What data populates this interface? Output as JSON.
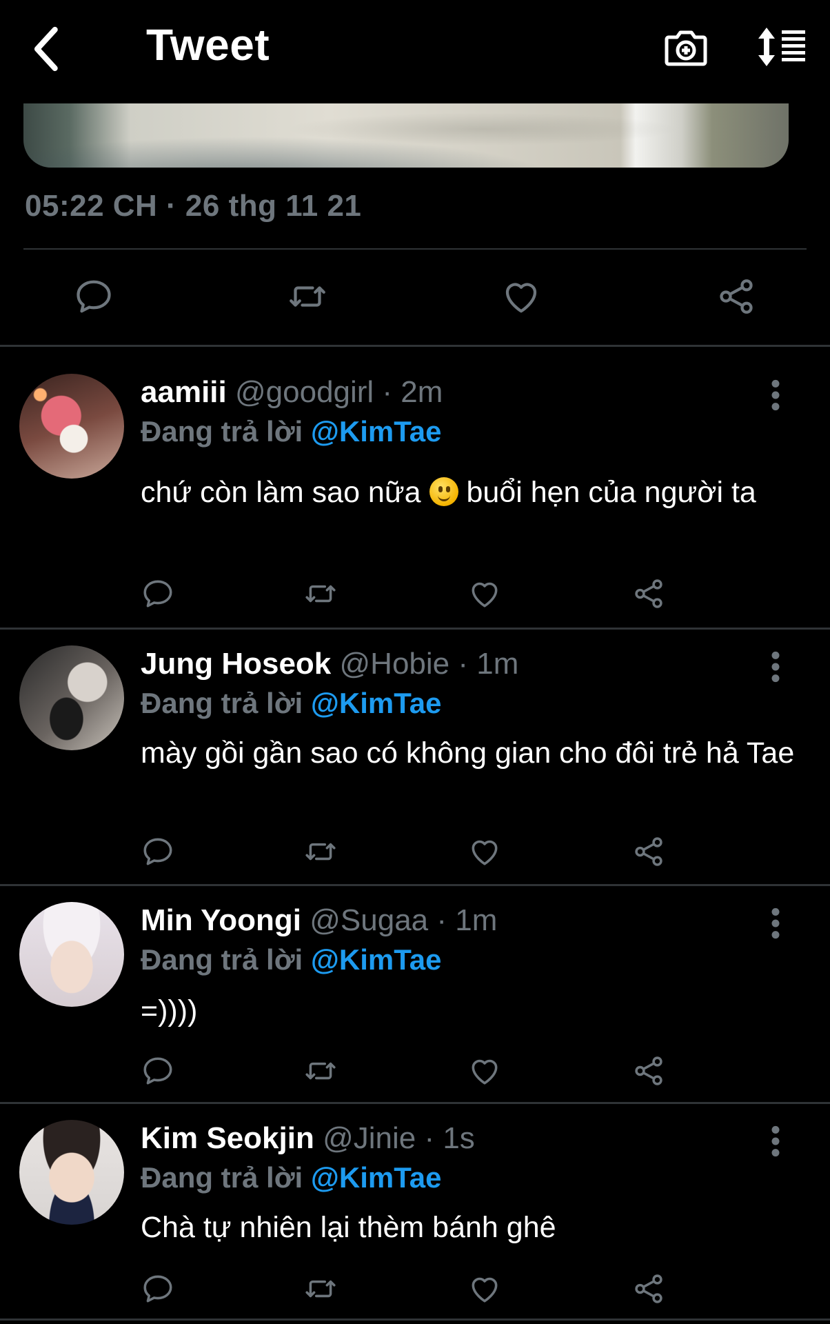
{
  "header": {
    "title": "Tweet",
    "back_icon": "chevron-left-icon",
    "camera_icon": "camera-plus-icon",
    "sort_icon": "sort-list-icon"
  },
  "tweet": {
    "timestamp": "05:22 CH · 26 thg 11 21"
  },
  "colors": {
    "background": "#000000",
    "secondary_text": "#6e767d",
    "accent": "#1d9bf0",
    "divider": "#2f3336"
  },
  "replies": [
    {
      "name": "aamiii",
      "handle": "@goodgirl · 2m",
      "replying_prefix": "Đang trả lời",
      "replying_to": "@KimTae",
      "text_before_emoji": "chứ còn làm sao nữa ",
      "emoji": "slightly-smiling-face",
      "text_after_emoji": " buổi hẹn của người ta"
    },
    {
      "name": "Jung Hoseok",
      "handle": "@Hobie · 1m",
      "replying_prefix": "Đang trả lời",
      "replying_to": "@KimTae",
      "text": "mày gồi gần sao có không gian cho đôi trẻ hả Tae"
    },
    {
      "name": "Min Yoongi",
      "handle": "@Sugaa · 1m",
      "replying_prefix": "Đang trả lời",
      "replying_to": "@KimTae",
      "text": "=))))"
    },
    {
      "name": "Kim Seokjin",
      "handle": "@Jinie · 1s",
      "replying_prefix": "Đang trả lời",
      "replying_to": "@KimTae",
      "text": "Chà tự nhiên lại thèm bánh ghê"
    }
  ]
}
